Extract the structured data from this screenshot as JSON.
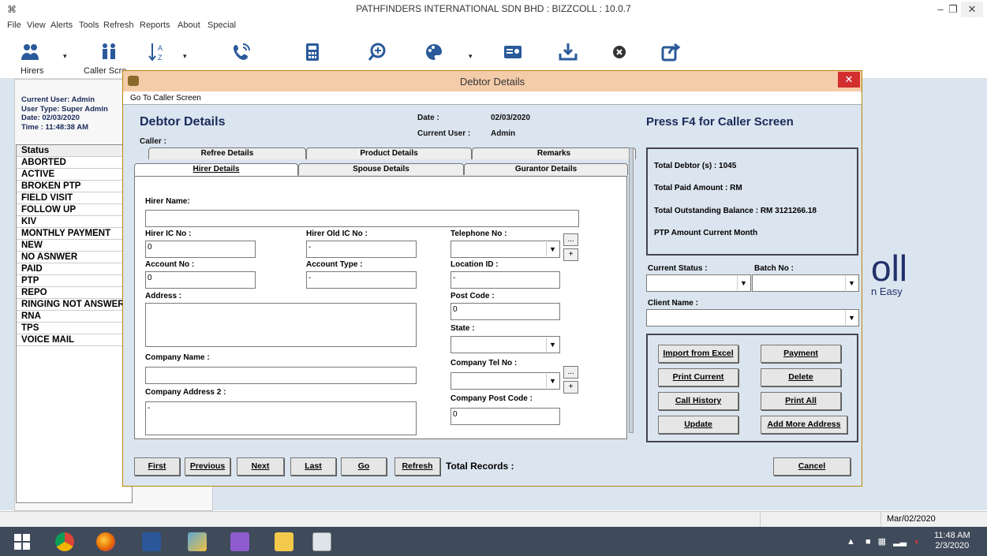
{
  "window": {
    "title": "PATHFINDERS INTERNATIONAL SDN BHD  :  BIZZCOLL  : 10.0.7",
    "app_icon": "⌘",
    "minimize": "–",
    "maximize": "❐",
    "close": "✕"
  },
  "menu": [
    "File",
    "View",
    "Alerts",
    "Tools",
    "Refresh",
    "Reports",
    "About",
    "Special"
  ],
  "toolbar": {
    "hirers_label": "Hirers",
    "caller_label": "Caller Scre",
    "dropdown_glyph": "▾",
    "icons": [
      "people-icon",
      "person-pair-icon",
      "sort-az-icon",
      "phone-call-icon",
      "calculator-icon",
      "zoom-in-icon",
      "palette-icon",
      "contact-card-icon",
      "download-icon",
      "close-circle-icon",
      "share-icon"
    ]
  },
  "session": {
    "current_user": "Current User: Admin",
    "user_type": "User Type: Super Admin",
    "date": "Date: 02/03/2020",
    "time": "Time : 11:48:38 AM"
  },
  "status_list": {
    "header": "Status",
    "items": [
      "ABORTED",
      "ACTIVE",
      "BROKEN PTP",
      "FIELD VISIT",
      "FOLLOW UP",
      "KIV",
      "MONTHLY PAYMENT",
      "NEW",
      "NO ASNWER",
      "PAID",
      "PTP",
      "REPO",
      "RINGING NOT ANSWERED",
      "RNA",
      "TPS",
      "VOICE MAIL"
    ]
  },
  "background_logo": {
    "big": "oll",
    "small": "n Easy"
  },
  "statusbar": {
    "date": "Mar/02/2020"
  },
  "clock": {
    "time": "11:48 AM",
    "date": "2/3/2020"
  },
  "dialog": {
    "title": "Debtor Details",
    "close": "✕",
    "menu_item": "Go To Caller Screen",
    "heading": "Debtor Details",
    "caller_label": "Caller :",
    "date_label": "Date :",
    "date_value": "02/03/2020",
    "current_user_label": "Current User :",
    "current_user_value": "Admin",
    "press_f4": "Press F4 for Caller Screen",
    "tabs_top": [
      "Refree Details",
      "Product Details",
      "Remarks"
    ],
    "tabs_bottom": [
      "Hirer Details",
      "Spouse Details",
      "Gurantor Details"
    ],
    "form": {
      "hirer_name_label": "Hirer Name:",
      "hirer_name": "",
      "hirer_ic_label": "Hirer IC No :",
      "hirer_ic": "0",
      "hirer_old_ic_label": "Hirer Old IC No :",
      "hirer_old_ic": "-",
      "telephone_label": "Telephone No :",
      "telephone": "",
      "account_no_label": "Account No :",
      "account_no": "0",
      "account_type_label": "Account Type :",
      "account_type": "-",
      "location_label": "Location ID :",
      "location": "-",
      "address_label": "Address :",
      "address": "",
      "post_code_label": "Post Code :",
      "post_code": "0",
      "state_label": "State :",
      "state": "",
      "company_name_label": "Company Name :",
      "company_name": "",
      "company_tel_label": "Company Tel No :",
      "company_tel": "",
      "company_address2_label": "Company Address 2 :",
      "company_address2": "-",
      "company_post_code_label": "Company Post Code :",
      "company_post_code": "0",
      "more_button": "...",
      "plus_button": "+",
      "dropdown_glyph": "▼"
    },
    "summary": {
      "total_debtors": "Total Debtor (s) : 1045",
      "total_paid": "Total Paid Amount : RM",
      "total_outstanding": "Total Outstanding Balance : RM 3121266.18",
      "ptp_amount": "PTP Amount Current Month"
    },
    "filters": {
      "current_status_label": "Current Status :",
      "batch_no_label": "Batch No :",
      "client_name_label": "Client Name :"
    },
    "actions": [
      "Import from Excel",
      "Payment",
      "Print Current",
      "Delete",
      "Call History",
      "Print All",
      "Update",
      "Add More Address"
    ],
    "nav": [
      "First",
      "Previous",
      "Next",
      "Last",
      "Go",
      "Refresh"
    ],
    "total_records": "Total Records :",
    "cancel": "Cancel"
  }
}
